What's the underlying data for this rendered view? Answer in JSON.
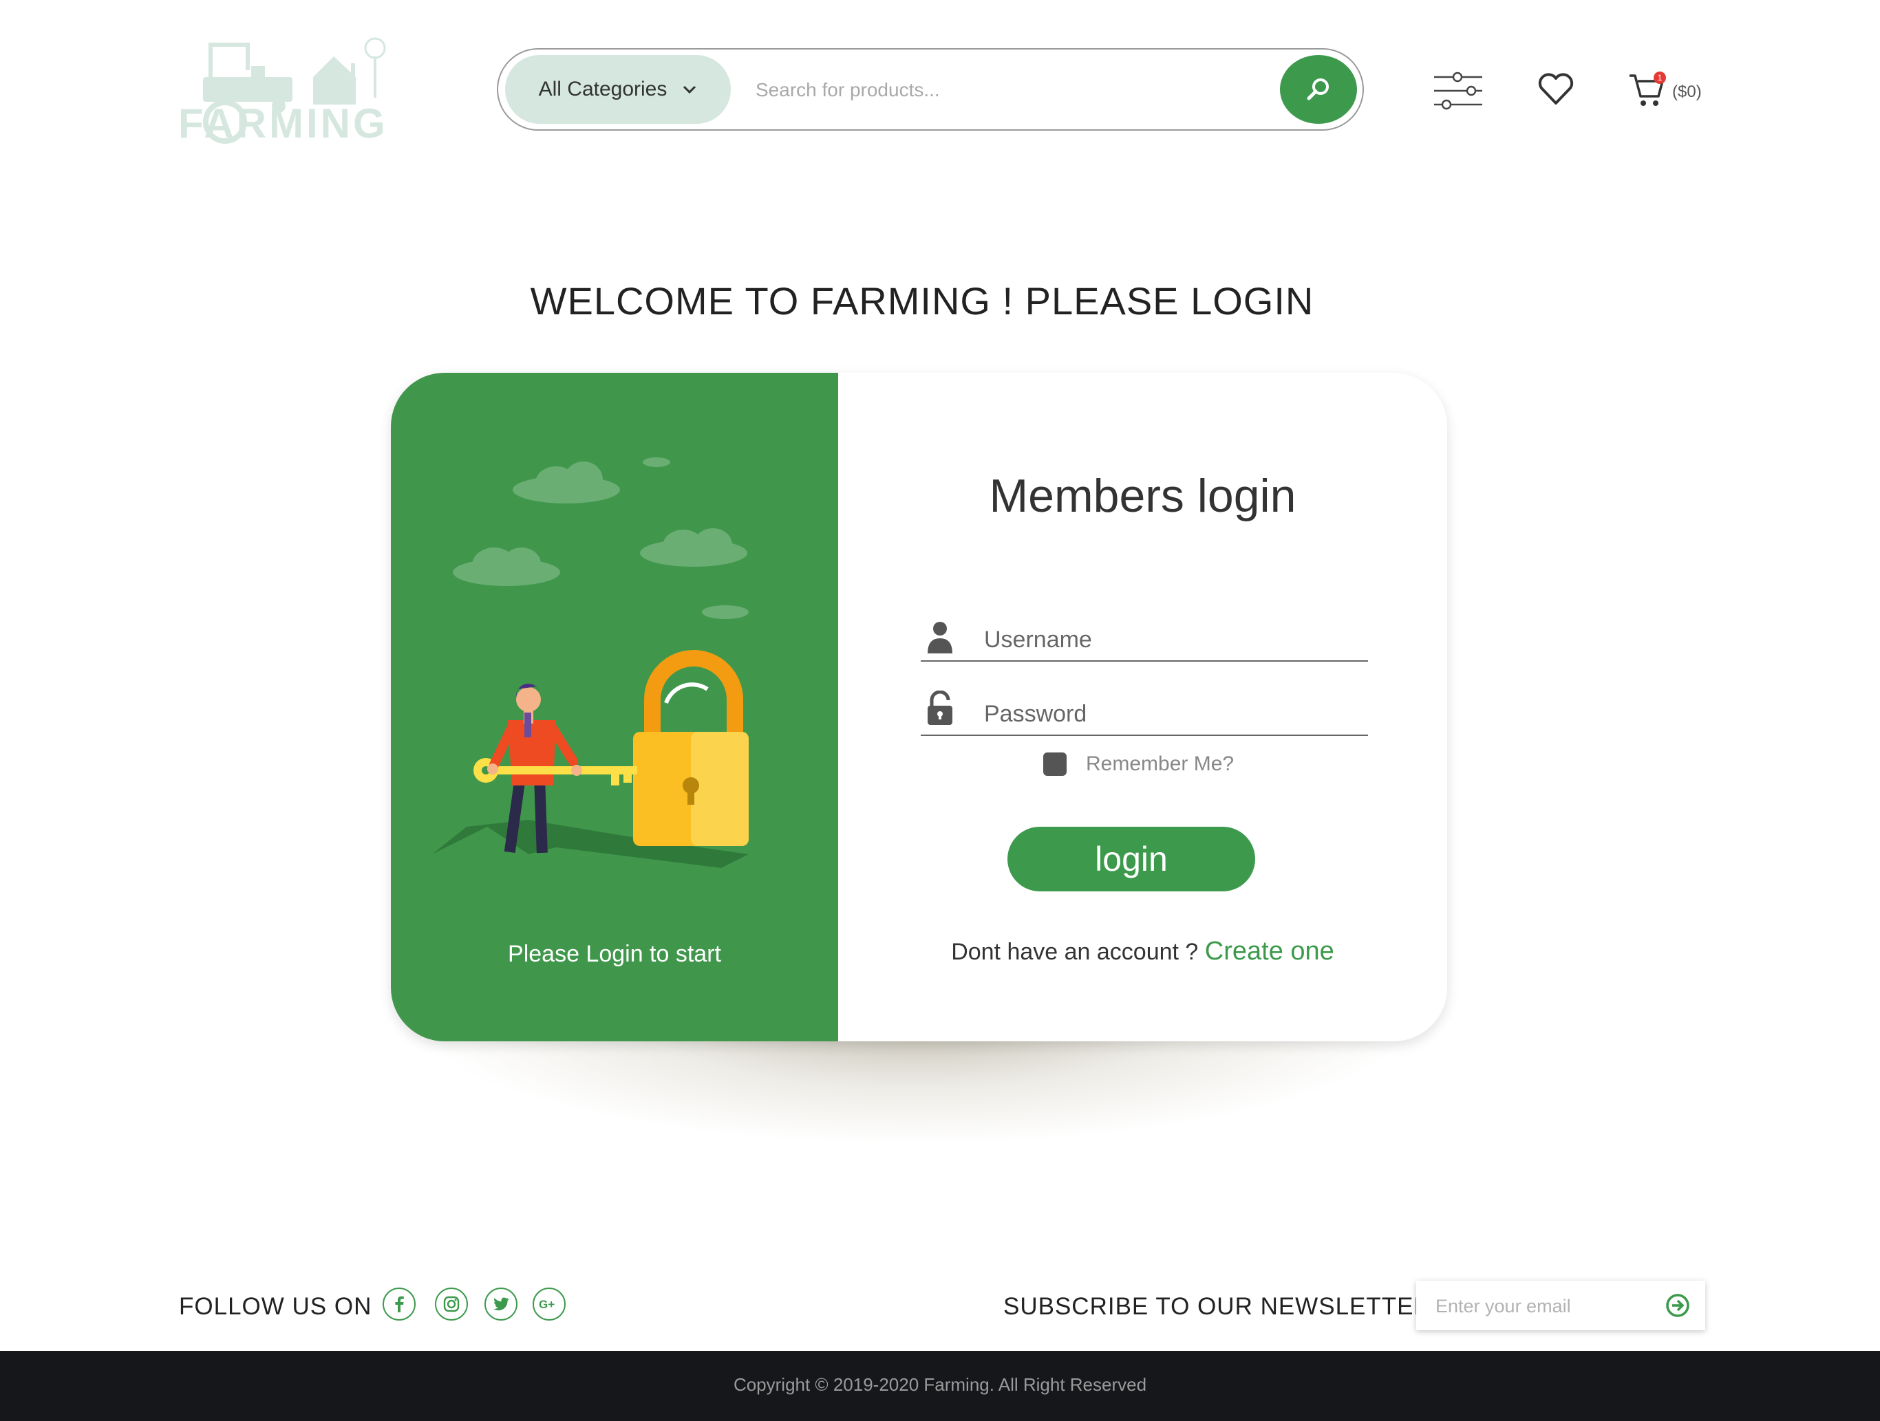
{
  "header": {
    "logo_text": "FARMING",
    "category_label": "All Categories",
    "search_placeholder": "Search for products...",
    "cart_amount": "($0)",
    "cart_count": "1"
  },
  "page": {
    "welcome_title": "WELCOME TO FARMING ! PLEASE LOGIN"
  },
  "login_card": {
    "left_caption": "Please Login to start",
    "title": "Members login",
    "username_placeholder": "Username",
    "password_placeholder": "Password",
    "remember_label": "Remember Me?",
    "login_button": "login",
    "signup_prompt": "Dont have an account ? ",
    "signup_link": "Create one"
  },
  "footer": {
    "follow_label": "FOLLOW US ON",
    "social_icons": [
      "facebook-icon",
      "instagram-icon",
      "twitter-icon",
      "google-plus-icon"
    ],
    "newsletter_label": "SUBSCRIBE TO OUR NEWSLETTER",
    "email_placeholder": "Enter your email",
    "copyright": "Copyright © 2019-2020 Farming. All Right Reserved"
  },
  "colors": {
    "brand_green": "#3d9a4d",
    "panel_green": "#40974c",
    "logo_tint": "#d5e7df",
    "footer_dark": "#16171b",
    "lock_yellow": "#fbbf24"
  }
}
